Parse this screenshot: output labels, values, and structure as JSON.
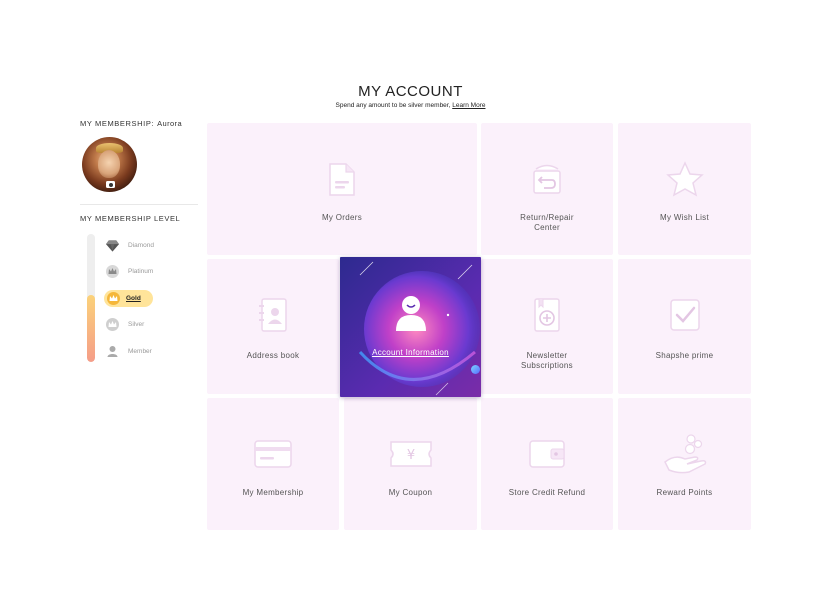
{
  "header": {
    "title": "MY ACCOUNT",
    "subtitle": "Spend any amount to be silver member,",
    "learn_more": "Learn More"
  },
  "sidebar": {
    "membership_title": "MY MEMBERSHIP:",
    "username": "Aurora",
    "level_title": "MY MEMBERSHIP LEVEL",
    "progress_fraction": 0.52,
    "levels": [
      {
        "label": "Diamond",
        "icon": "diamond-icon"
      },
      {
        "label": "Platinum",
        "icon": "platinum-crown-icon"
      },
      {
        "label": "Gold",
        "icon": "gold-crown-icon",
        "active": true
      },
      {
        "label": "Silver",
        "icon": "silver-crown-icon"
      },
      {
        "label": "Member",
        "icon": "member-icon"
      }
    ]
  },
  "tiles": {
    "orders": {
      "label": "My Orders",
      "icon": "document-icon"
    },
    "return": {
      "line1": "Return/Repair",
      "line2": "Center",
      "icon": "return-box-icon"
    },
    "wishlist": {
      "label": "My Wish List",
      "icon": "star-icon"
    },
    "address": {
      "label": "Address book",
      "icon": "address-book-icon"
    },
    "account": {
      "label": "Account Information",
      "icon": "user-icon"
    },
    "newsletter": {
      "line1": "Newsletter",
      "line2": "Subscriptions",
      "icon": "subscription-icon"
    },
    "prime": {
      "label": "Shapshe prime",
      "icon": "checkmark-icon"
    },
    "membership": {
      "label": "My Membership",
      "icon": "card-icon"
    },
    "coupon": {
      "label": "My Coupon",
      "icon": "coupon-icon"
    },
    "refund": {
      "label": "Store Credit Refund",
      "icon": "wallet-icon"
    },
    "points": {
      "label": "Reward Points",
      "icon": "hand-coins-icon"
    }
  },
  "colors": {
    "tile_bg": "#fbf1fb",
    "icon_light": "#ffffff",
    "icon_shadow": "#ecd6ec",
    "gold_highlight": "#ffe49a",
    "progress_top": "#fbd27a",
    "progress_bottom": "#f59d88",
    "featured_bg": "#4b2aa8"
  }
}
